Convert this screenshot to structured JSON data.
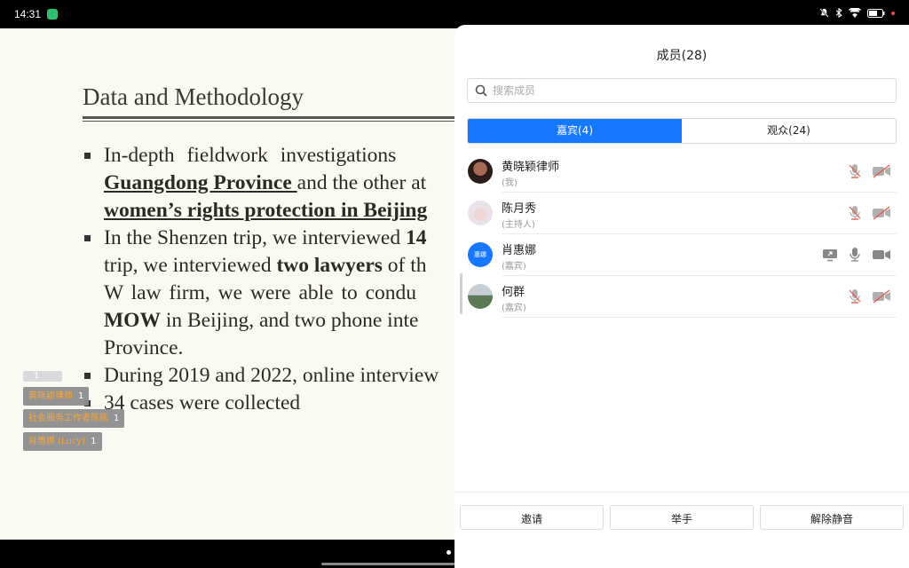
{
  "status_bar": {
    "time": "14:31"
  },
  "slide": {
    "title": "Data and Methodology",
    "b1_l1": "In-depth   fieldwork   investigations",
    "b1_l2_u": "Guangdong Province ",
    "b1_l2_rest": "and the other at",
    "b1_l3_u": "women’s rights protection in Beijing",
    "b2_l1_a": "In the Shenzen trip, we interviewed ",
    "b2_l1_b": "14",
    "b2_l2_a": "trip, we interviewed ",
    "b2_l2_b": "two lawyers",
    "b2_l2_c": " of th",
    "b2_l3": "W law firm, we were able to condu",
    "b2_l4_b": "MOW",
    "b2_l4_c": " in Beijing, and two phone inte",
    "b2_l5": "Province.",
    "b3_l1": "During 2019 and 2022, online interview",
    "b3_l2": "34 cases were collected"
  },
  "danmaku": [
    {
      "text": "",
      "count": "1"
    },
    {
      "text": "黄晓颖律师",
      "count": "1"
    },
    {
      "text": "社会服务工作者陈陈",
      "count": "1"
    },
    {
      "text": "肖惠娜 (Lucy)",
      "count": "1"
    }
  ],
  "panel": {
    "title": "成员(28)",
    "search_placeholder": "搜索成员",
    "tabs": [
      {
        "label": "嘉宾(4)"
      },
      {
        "label": "观众(24)"
      }
    ],
    "members": [
      {
        "name": "黄晓颖律师",
        "role": "(我)"
      },
      {
        "name": "陈月秀",
        "role": "(主持人)"
      },
      {
        "name": "肖惠娜",
        "role": "(嘉宾)",
        "avatar_text": "惠娜"
      },
      {
        "name": "何群",
        "role": "(嘉宾)"
      }
    ],
    "buttons": {
      "invite": "邀请",
      "raise_hand": "举手",
      "unmute": "解除静音"
    }
  },
  "colors": {
    "accent": "#1677ff",
    "muted_icon": "#b0b0b0",
    "mute_red": "#e05a4a"
  }
}
